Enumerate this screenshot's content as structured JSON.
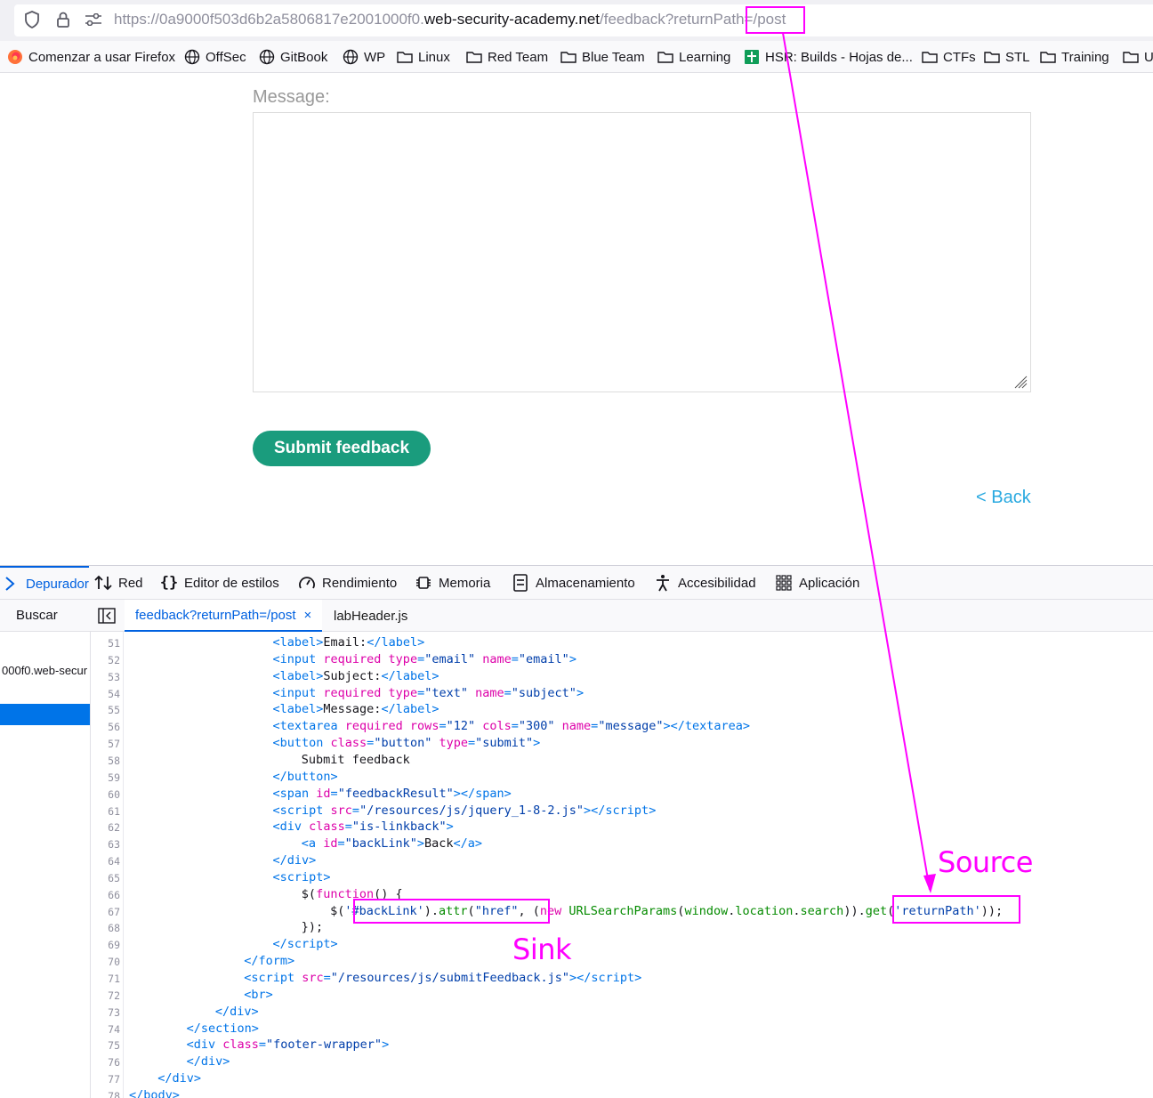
{
  "browser": {
    "url_prefix": "https://0a9000f503d6b2a5806817e2001000f0.",
    "url_host": "web-security-academy.net",
    "url_path": "/feedback?returnPath=/post",
    "icons": [
      "shield-icon",
      "lock-icon",
      "permissions-icon"
    ]
  },
  "bookmarks": [
    {
      "label": "Comenzar a usar Firefox",
      "icon": "firefox-icon"
    },
    {
      "label": "OffSec",
      "icon": "globe-icon"
    },
    {
      "label": "GitBook",
      "icon": "globe-icon"
    },
    {
      "label": "WP",
      "icon": "globe-icon"
    },
    {
      "label": "Linux",
      "icon": "folder-icon"
    },
    {
      "label": "Red Team",
      "icon": "folder-icon"
    },
    {
      "label": "Blue Team",
      "icon": "folder-icon"
    },
    {
      "label": "Learning",
      "icon": "folder-icon"
    },
    {
      "label": "HSR: Builds - Hojas de...",
      "icon": "sheets-icon"
    },
    {
      "label": "CTFs",
      "icon": "folder-icon"
    },
    {
      "label": "STL",
      "icon": "folder-icon"
    },
    {
      "label": "Training",
      "icon": "folder-icon"
    },
    {
      "label": "U",
      "icon": "folder-icon"
    }
  ],
  "page": {
    "message_label": "Message:",
    "submit_label": "Submit feedback",
    "back_label": "< Back"
  },
  "devtools": {
    "tabs": [
      {
        "label": "Depurador",
        "icon": "debugger-icon",
        "active": true
      },
      {
        "label": "Red",
        "icon": "network-icon"
      },
      {
        "label": "Editor de estilos",
        "icon": "style-editor-icon"
      },
      {
        "label": "Rendimiento",
        "icon": "performance-icon"
      },
      {
        "label": "Memoria",
        "icon": "memory-icon"
      },
      {
        "label": "Almacenamiento",
        "icon": "storage-icon"
      },
      {
        "label": "Accesibilidad",
        "icon": "accessibility-icon"
      },
      {
        "label": "Aplicación",
        "icon": "application-icon"
      }
    ],
    "search_label": "Buscar",
    "source_tabs": [
      {
        "label": "feedback?returnPath=/post",
        "close": "×",
        "active": true
      },
      {
        "label": "labHeader.js"
      }
    ],
    "sidebar_host": "000f0.web-secur",
    "line_numbers": [
      "51",
      "52",
      "53",
      "54",
      "55",
      "56",
      "57",
      "58",
      "59",
      "60",
      "61",
      "62",
      "63",
      "64",
      "65",
      "66",
      "67",
      "68",
      "69",
      "70",
      "71",
      "72",
      "73",
      "74",
      "75",
      "76",
      "77",
      "78"
    ]
  },
  "annotations": {
    "source_label": "Source",
    "sink_label": "Sink",
    "color": "#ff00ff"
  }
}
